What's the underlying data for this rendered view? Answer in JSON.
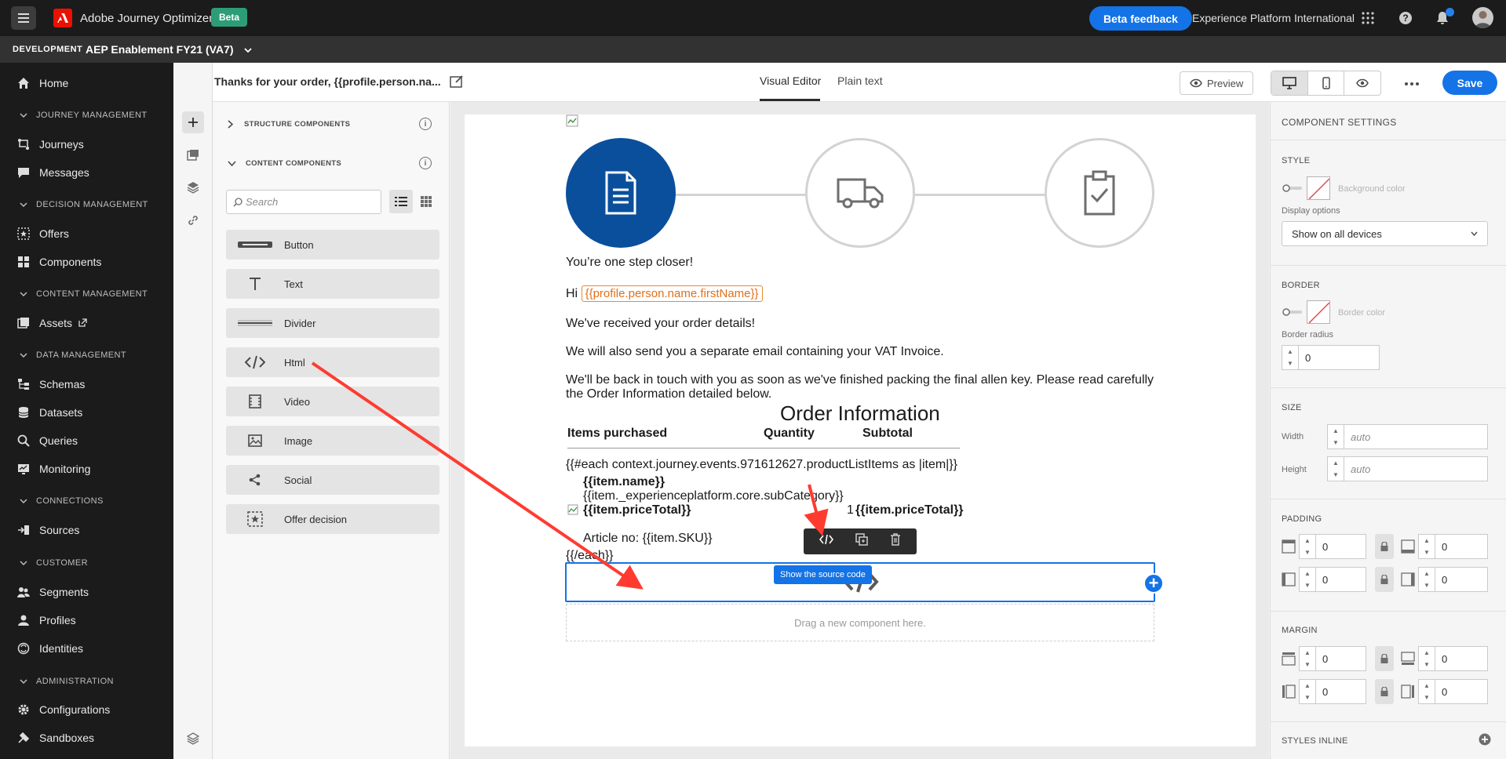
{
  "app": {
    "title": "Adobe Journey Optimizer",
    "beta_badge": "Beta",
    "feedback_button": "Beta feedback",
    "org_name": "Experience Platform International"
  },
  "env": {
    "tag": "DEVELOPMENT",
    "sandbox": "AEP Enablement FY21 (VA7)"
  },
  "nav": {
    "home": "Home",
    "sec_journey": "JOURNEY MANAGEMENT",
    "journeys": "Journeys",
    "messages": "Messages",
    "sec_decision": "DECISION MANAGEMENT",
    "offers": "Offers",
    "components": "Components",
    "sec_content": "CONTENT MANAGEMENT",
    "assets": "Assets",
    "sec_data": "DATA MANAGEMENT",
    "schemas": "Schemas",
    "datasets": "Datasets",
    "queries": "Queries",
    "monitoring": "Monitoring",
    "sec_connections": "CONNECTIONS",
    "sources": "Sources",
    "sec_customer": "CUSTOMER",
    "segments": "Segments",
    "profiles": "Profiles",
    "identities": "Identities",
    "sec_admin": "ADMINISTRATION",
    "configurations": "Configurations",
    "sandboxes": "Sandboxes"
  },
  "header": {
    "message_title": "Thanks for your order, {{profile.person.na...",
    "tab_visual": "Visual Editor",
    "tab_plain": "Plain text",
    "preview": "Preview",
    "save": "Save"
  },
  "components_panel": {
    "structure_title": "STRUCTURE COMPONENTS",
    "content_title": "CONTENT COMPONENTS",
    "search_placeholder": "Search",
    "items": [
      "Button",
      "Text",
      "Divider",
      "Html",
      "Video",
      "Image",
      "Social",
      "Offer decision"
    ]
  },
  "email": {
    "closer": "You’re one step closer!",
    "hi": "Hi",
    "first_name_token": "{{profile.person.name.firstName}}",
    "received": "We've received your order details!",
    "vat": "We will also send you a separate email containing your VAT Invoice.",
    "back_line1": "We'll be back in touch with you as soon as we've finished packing the final allen key. Please read carefully",
    "back_line2": "the Order Information detailed below.",
    "order_title": "Order Information",
    "col_items": "Items purchased",
    "col_qty": "Quantity",
    "col_subtotal": "Subtotal",
    "each_open": "{{#each context.journey.events.971612627.productListItems as |item|}}",
    "item_name": "{{item.name}}",
    "item_subcat": "{{item._experienceplatform.core.subCategory}}",
    "item_price": "{{item.priceTotal}}",
    "qty_value": "1",
    "item_price_sub": "{{item.priceTotal}}",
    "article": "Article no: {{item.SKU}}",
    "each_close": "{{/each}}",
    "tooltip": "Show the source code",
    "dropzone": "Drag a new component here."
  },
  "settings": {
    "title": "COMPONENT SETTINGS",
    "style": "STYLE",
    "bg_color": "Background color",
    "display_options": "Display options",
    "display_value": "Show on all devices",
    "border": "BORDER",
    "border_color": "Border color",
    "border_radius": "Border radius",
    "border_radius_value": "0",
    "size": "SIZE",
    "width": "Width",
    "width_placeholder": "auto",
    "height": "Height",
    "height_placeholder": "auto",
    "padding": "PADDING",
    "margin": "MARGIN",
    "zero": "0",
    "styles_inline": "STYLES INLINE"
  },
  "colors": {
    "accent": "#1473e6",
    "nav_bg": "#1b1b1b",
    "circle_blue": "#0a4f9c",
    "token_orange": "#e0701a",
    "arrow_red": "#ff3b30"
  }
}
